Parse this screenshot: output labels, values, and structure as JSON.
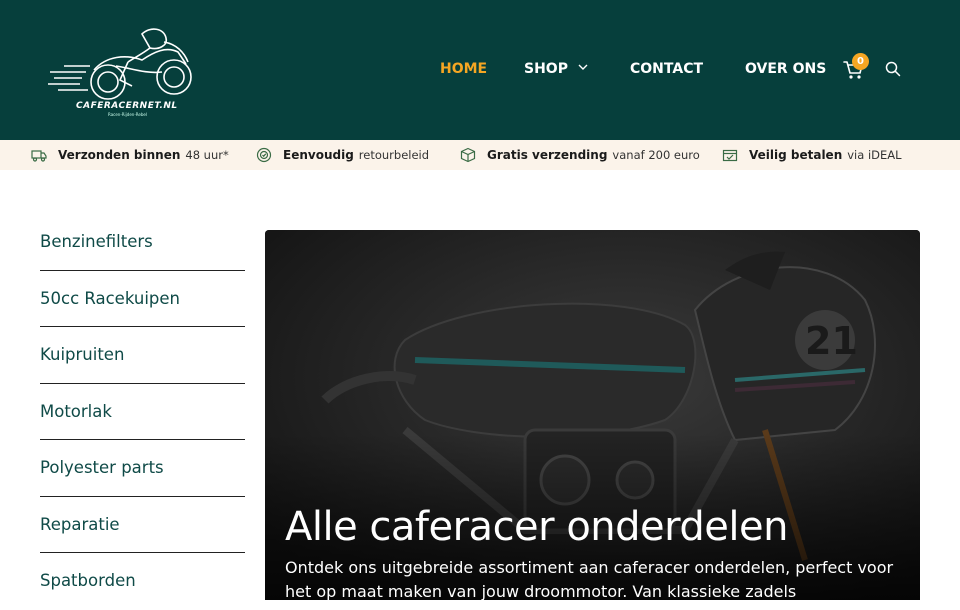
{
  "brand": {
    "logo_text": "CAFERACERNET.NL",
    "logo_tagline": "Racen-Rijden-Rebel"
  },
  "nav": {
    "items": [
      {
        "label": "HOME",
        "active": true
      },
      {
        "label": "SHOP",
        "has_dropdown": true
      },
      {
        "label": "CONTACT"
      },
      {
        "label": "OVER ONS"
      }
    ],
    "cart_count": "0",
    "icons": {
      "cart": "cart-icon",
      "search": "search-icon",
      "dropdown": "chevron-down-icon"
    }
  },
  "usp": [
    {
      "icon": "delivery-truck-icon",
      "strong": "Verzonden binnen",
      "light": "48 uur*"
    },
    {
      "icon": "return-badge-icon",
      "strong": "Eenvoudig",
      "light": "retourbeleid"
    },
    {
      "icon": "package-box-icon",
      "strong": "Gratis verzending",
      "light": "vanaf 200 euro"
    },
    {
      "icon": "secure-payment-icon",
      "strong": "Veilig betalen",
      "light": "via iDEAL"
    }
  ],
  "sidebar": {
    "items": [
      {
        "label": "Benzinefilters"
      },
      {
        "label": "50cc Racekuipen"
      },
      {
        "label": "Kuipruiten"
      },
      {
        "label": "Motorlak"
      },
      {
        "label": "Polyester parts"
      },
      {
        "label": "Reparatie"
      },
      {
        "label": "Spatborden"
      }
    ]
  },
  "hero": {
    "title": "Alle caferacer onderdelen",
    "description": "Ontdek ons uitgebreide assortiment aan caferacer onderdelen, perfect voor het op maat maken van jouw droommotor. Van klassieke zadels"
  },
  "colors": {
    "header_bg": "#063f3c",
    "accent": "#f5a623",
    "usp_bg": "#fbf3ea",
    "sidebar_text": "#0f4a47"
  }
}
